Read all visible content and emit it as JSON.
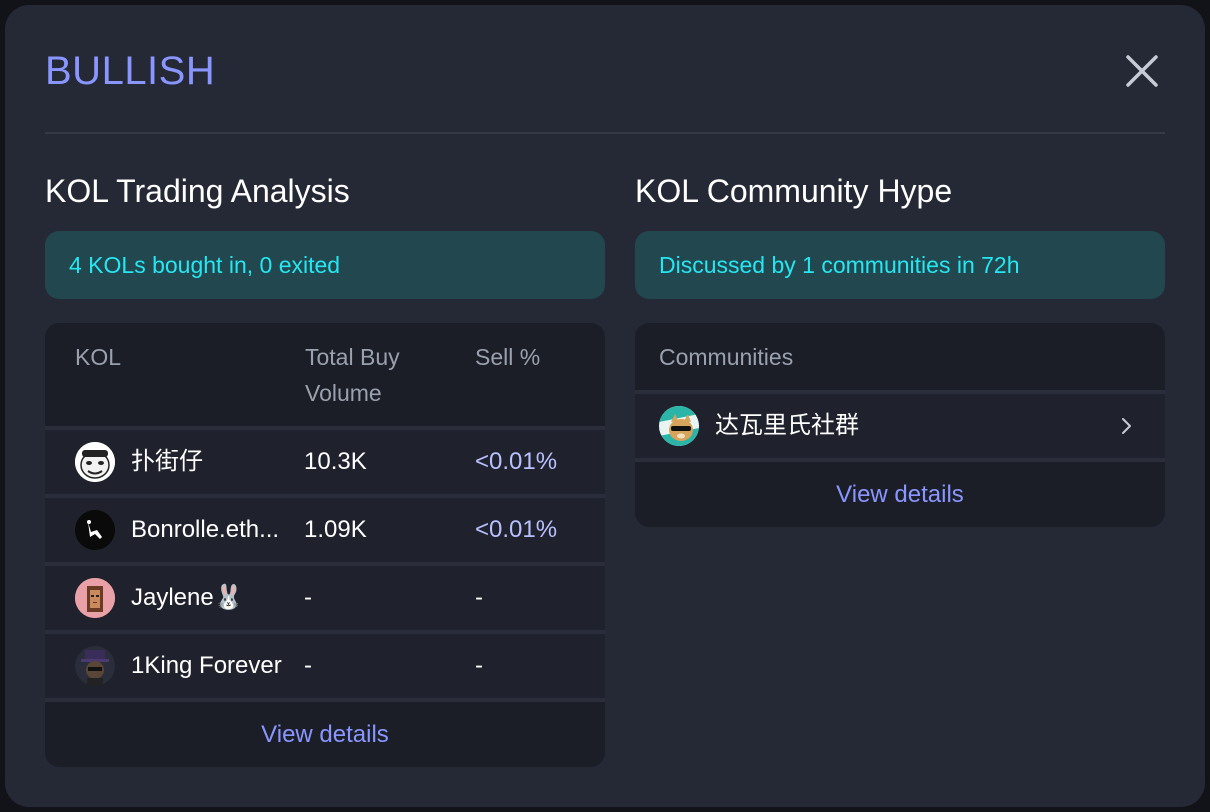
{
  "modal": {
    "title": "BULLISH"
  },
  "kol_trading": {
    "title": "KOL Trading Analysis",
    "summary": "4 KOLs bought in, 0 exited",
    "columns": {
      "kol": "KOL",
      "total_buy_volume": "Total Buy Volume",
      "sell_pct": "Sell %"
    },
    "rows": [
      {
        "name": "扑街仔",
        "volume": "10.3K",
        "sell": "<0.01%",
        "avatar": "meme-face-avatar"
      },
      {
        "name": "Bonrolle.eth...",
        "volume": "1.09K",
        "sell": "<0.01%",
        "avatar": "shaka-hand-avatar"
      },
      {
        "name": "Jaylene🐰",
        "volume": "-",
        "sell": "-",
        "avatar": "pixel-punk-avatar"
      },
      {
        "name": "1King Forever",
        "volume": "-",
        "sell": "-",
        "avatar": "dark-character-avatar"
      }
    ],
    "view_details": "View details"
  },
  "community_hype": {
    "title": "KOL Community Hype",
    "summary": "Discussed by 1 communities in 72h",
    "column": "Communities",
    "rows": [
      {
        "name": "达瓦里氏社群",
        "avatar": "doge-sunglasses-avatar"
      }
    ],
    "view_details": "View details"
  },
  "colors": {
    "accent": "#8a96ff",
    "cyan": "#24e7f2",
    "panel": "#252935"
  }
}
